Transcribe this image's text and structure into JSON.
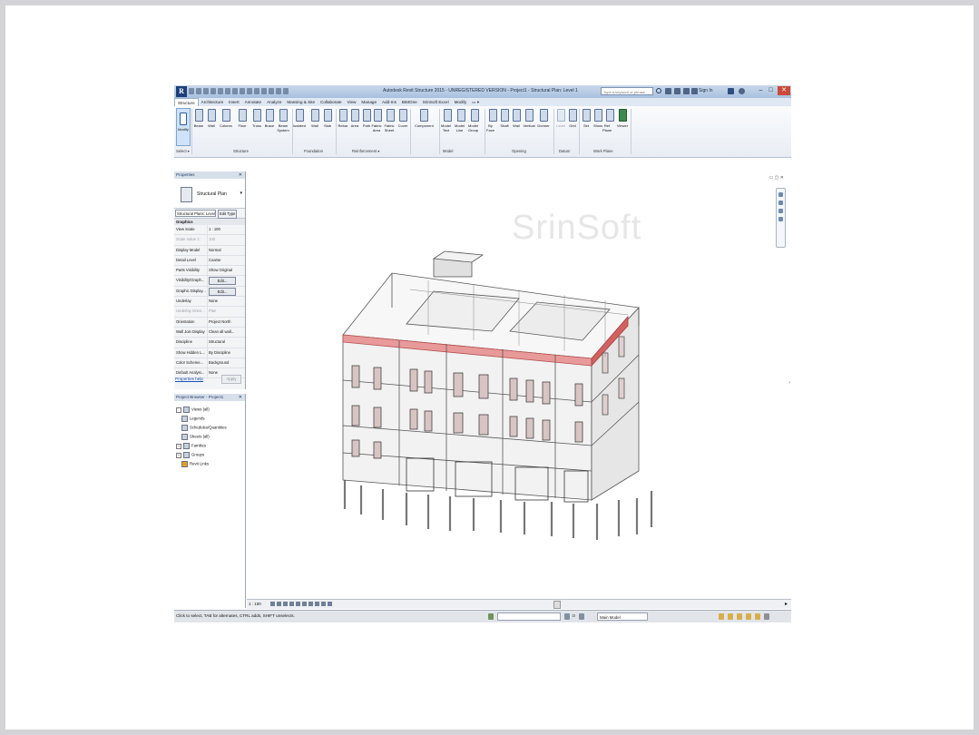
{
  "app": {
    "logo_letter": "R",
    "title": "Autodesk Revit Structure 2015 - UNREGISTERED VERSION - Project1 - Structural Plan: Level 1",
    "search_placeholder": "Type a keyword or phrase",
    "sign_in": "Sign In",
    "min": "–",
    "max": "□",
    "close": "✕"
  },
  "ribbon": {
    "tabs": [
      "Structure",
      "Architecture",
      "Insert",
      "Annotate",
      "Analyze",
      "Massing & Site",
      "Collaborate",
      "View",
      "Manage",
      "Add-Ins",
      "BIMOne",
      "SrinSoft Excel",
      "Modify",
      "▭ ▾"
    ],
    "modify_label": "Modify",
    "select_label": "Select ▾",
    "structure_tools": [
      "Beam",
      "Wall",
      "Column",
      "Floor",
      "Truss",
      "Brace",
      "Beam System"
    ],
    "foundation_tools": [
      "Isolated",
      "Wall",
      "Slab"
    ],
    "reinforcement_tools": [
      "Rebar",
      "Area",
      "Path",
      "Fabric Area",
      "Fabric Sheet",
      "Cover"
    ],
    "component_tool": "Component",
    "model_tools": [
      "Model Text",
      "Model Line",
      "Model Group"
    ],
    "opening_tools": [
      "By Face",
      "Shaft",
      "Wall",
      "Vertical",
      "Dormer"
    ],
    "datum_tools": [
      "Level",
      "Grid"
    ],
    "workplane_tools": [
      "Set",
      "Show",
      "Ref Plane",
      "Viewer"
    ],
    "panels": {
      "structure": "Structure",
      "foundation": "Foundation",
      "reinforcement": "Reinforcement ▾",
      "model": "Model",
      "opening": "Opening",
      "datum": "Datum",
      "work_plane": "Work Plane"
    }
  },
  "properties": {
    "title": "Properties",
    "close": "✕",
    "type_name": "Structural Plan",
    "filter": "Structural Plans: Level 1",
    "edit_type": "Edit Type",
    "group": "Graphics",
    "rows": [
      {
        "k": "View Scale",
        "v": "1 : 100"
      },
      {
        "k": "Scale Value    1:",
        "v": "100"
      },
      {
        "k": "Display Model",
        "v": "Normal"
      },
      {
        "k": "Detail Level",
        "v": "Coarse"
      },
      {
        "k": "Parts Visibility",
        "v": "Show Original"
      },
      {
        "k": "Visibility/Graph...",
        "v": "Edit..."
      },
      {
        "k": "Graphic Display...",
        "v": "Edit..."
      },
      {
        "k": "Underlay",
        "v": "None"
      },
      {
        "k": "Underlay Orien...",
        "v": "Plan"
      },
      {
        "k": "Orientation",
        "v": "Project North"
      },
      {
        "k": "Wall Join Display",
        "v": "Clean all wall..."
      },
      {
        "k": "Discipline",
        "v": "Structural"
      },
      {
        "k": "Show Hidden L...",
        "v": "By Discipline"
      },
      {
        "k": "Color Scheme...",
        "v": "Background"
      },
      {
        "k": "Default Analysi...",
        "v": "None"
      }
    ],
    "help": "Properties help",
    "apply": "Apply"
  },
  "browser": {
    "title": "Project Browser - Project1",
    "close": "✕",
    "items": [
      {
        "label": "Views (all)",
        "node": "-"
      },
      {
        "label": "Legends",
        "node": ""
      },
      {
        "label": "Schedules/Quantities",
        "node": ""
      },
      {
        "label": "Sheets (all)",
        "node": ""
      },
      {
        "label": "Families",
        "node": "+"
      },
      {
        "label": "Groups",
        "node": "+"
      },
      {
        "label": "Revit Links",
        "node": ""
      }
    ]
  },
  "view": {
    "watermark": "SrinSoft",
    "viewcube_label": "▭ ▢ ✕",
    "scale": "1 : 100"
  },
  "status": {
    "text": "Click to select, TAB for alternates, CTRL adds, SHIFT unselects.",
    "zero": ":0",
    "main_model": "Main Model"
  }
}
